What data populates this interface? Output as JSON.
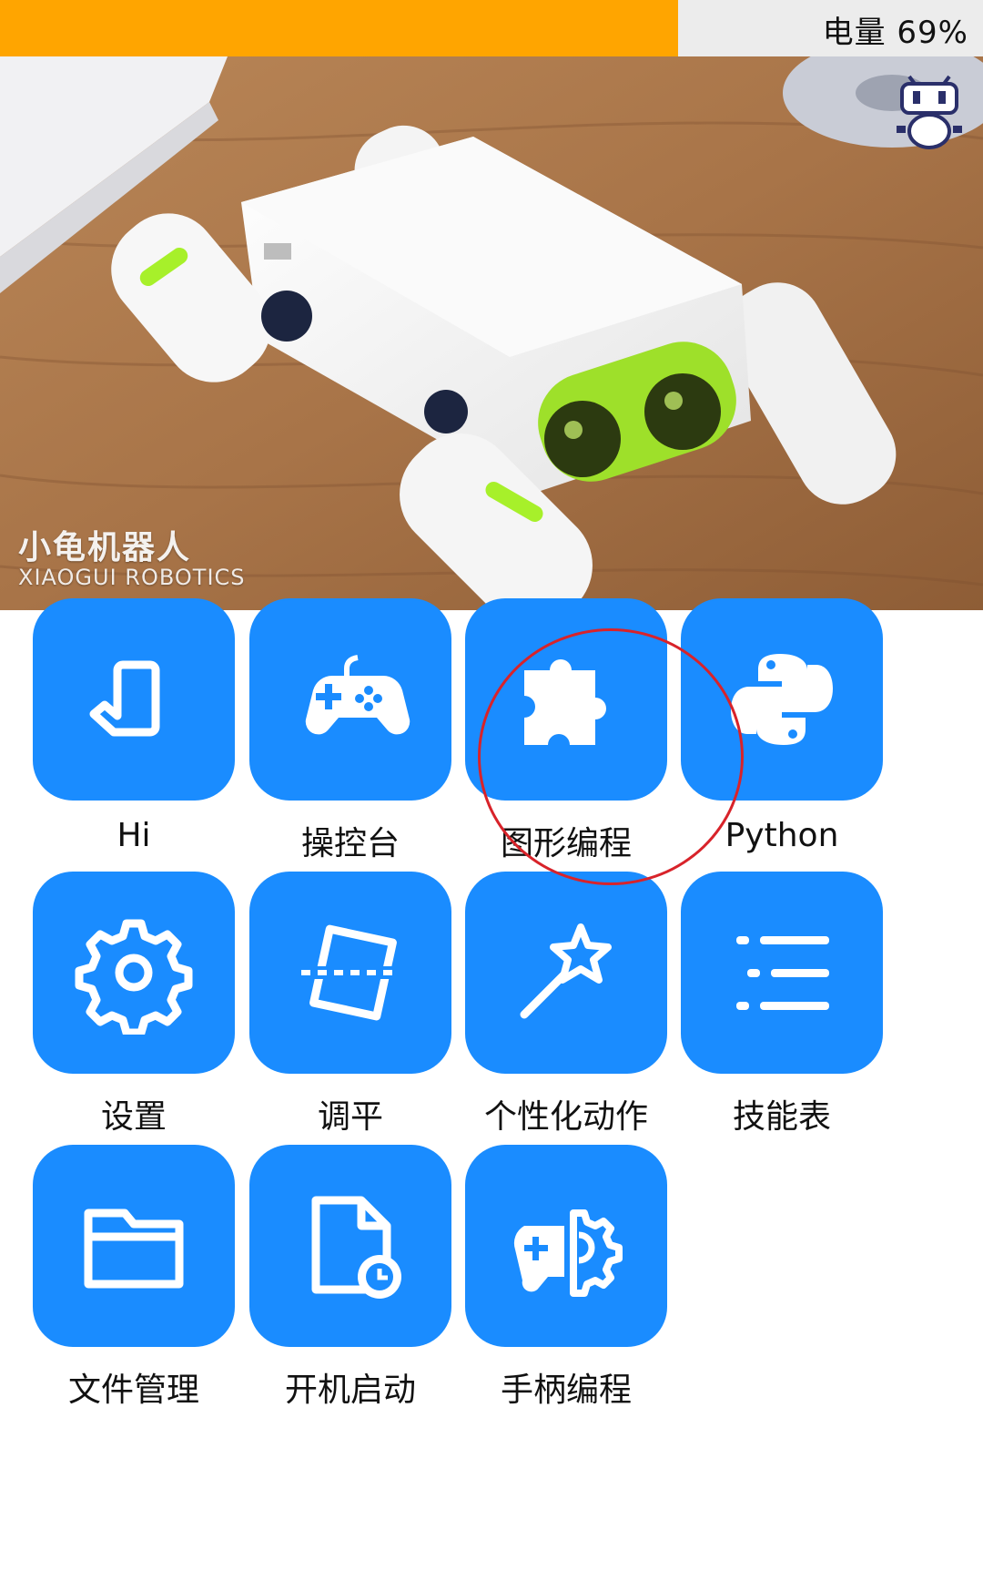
{
  "status": {
    "battery_text": "电量 69%",
    "battery_level": 0.69,
    "battery_color": "#ffa500"
  },
  "hero": {
    "brand_cn": "小龟机器人",
    "brand_en": "XIAOGUI ROBOTICS",
    "robot_icon": "robot-mascot-icon"
  },
  "accent_color": "#1a8cff",
  "apps": [
    {
      "label": "Hi",
      "icon": "hand-wave-icon"
    },
    {
      "label": "操控台",
      "icon": "gamepad-icon"
    },
    {
      "label": "图形编程",
      "icon": "puzzle-piece-icon"
    },
    {
      "label": "Python",
      "icon": "python-logo-icon"
    },
    {
      "label": "设置",
      "icon": "gear-icon"
    },
    {
      "label": "调平",
      "icon": "level-calibrate-icon"
    },
    {
      "label": "个性化动作",
      "icon": "magic-wand-icon"
    },
    {
      "label": "技能表",
      "icon": "list-icon"
    },
    {
      "label": "文件管理",
      "icon": "folder-icon"
    },
    {
      "label": "开机启动",
      "icon": "file-clock-icon"
    },
    {
      "label": "手柄编程",
      "icon": "gamepad-gear-icon"
    }
  ]
}
